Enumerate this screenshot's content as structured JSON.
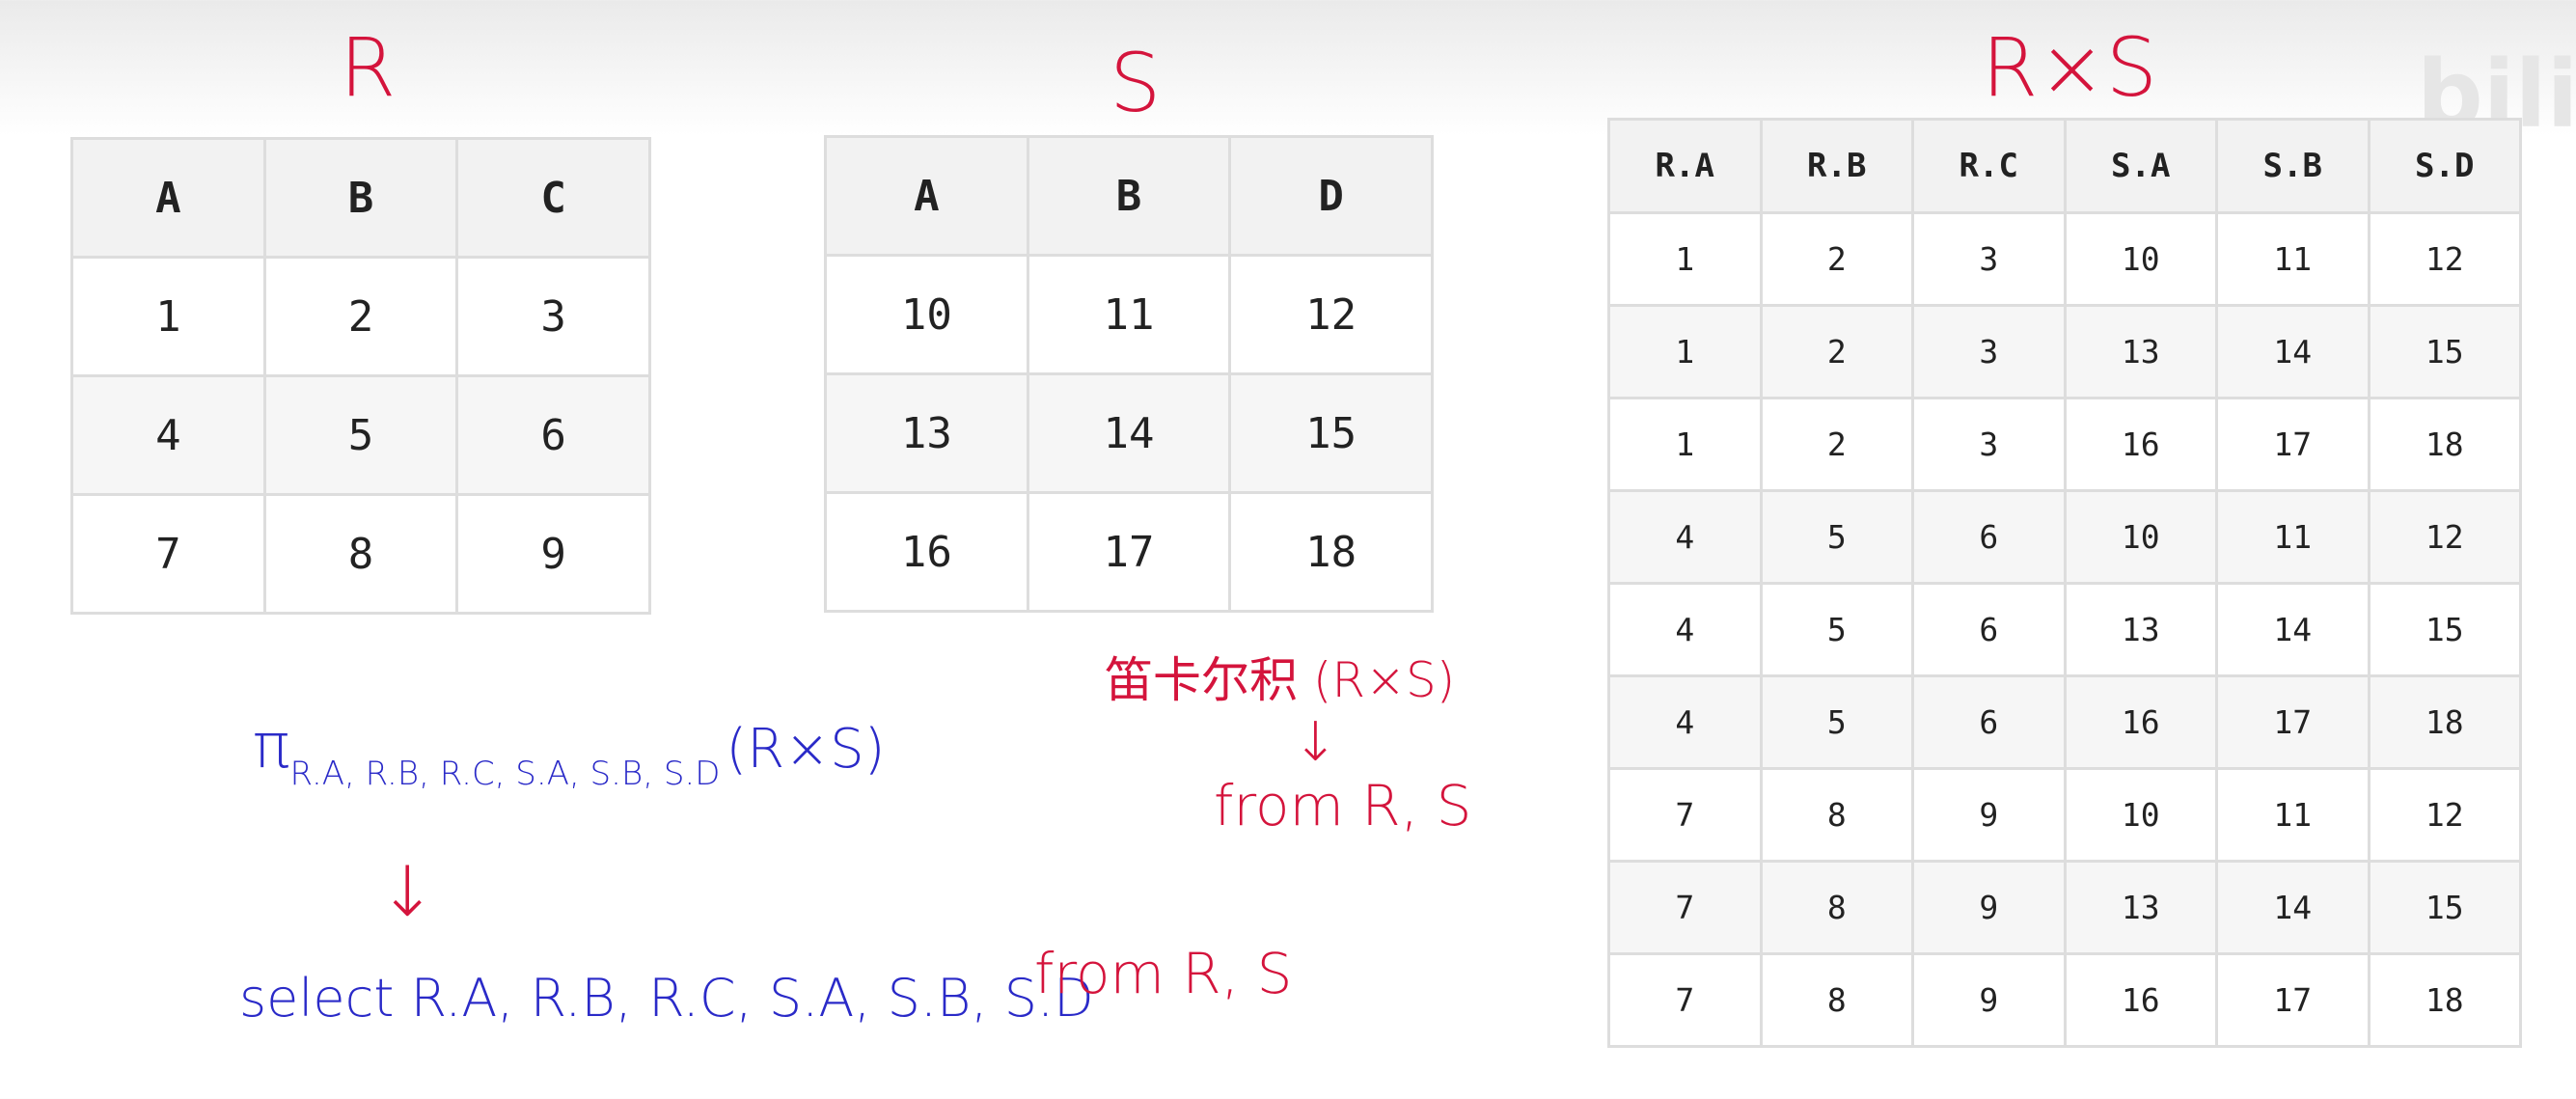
{
  "r_table": {
    "title": "R",
    "headers": [
      "A",
      "B",
      "C"
    ],
    "rows": [
      [
        "1",
        "2",
        "3"
      ],
      [
        "4",
        "5",
        "6"
      ],
      [
        "7",
        "8",
        "9"
      ]
    ]
  },
  "s_table": {
    "title": "S",
    "headers": [
      "A",
      "B",
      "D"
    ],
    "rows": [
      [
        "10",
        "11",
        "12"
      ],
      [
        "13",
        "14",
        "15"
      ],
      [
        "16",
        "17",
        "18"
      ]
    ]
  },
  "rxs_table": {
    "title": "R×S",
    "headers": [
      "R.A",
      "R.B",
      "R.C",
      "S.A",
      "S.B",
      "S.D"
    ],
    "rows": [
      [
        "1",
        "2",
        "3",
        "10",
        "11",
        "12"
      ],
      [
        "1",
        "2",
        "3",
        "13",
        "14",
        "15"
      ],
      [
        "1",
        "2",
        "3",
        "16",
        "17",
        "18"
      ],
      [
        "4",
        "5",
        "6",
        "10",
        "11",
        "12"
      ],
      [
        "4",
        "5",
        "6",
        "13",
        "14",
        "15"
      ],
      [
        "4",
        "5",
        "6",
        "16",
        "17",
        "18"
      ],
      [
        "7",
        "8",
        "9",
        "10",
        "11",
        "12"
      ],
      [
        "7",
        "8",
        "9",
        "13",
        "14",
        "15"
      ],
      [
        "7",
        "8",
        "9",
        "16",
        "17",
        "18"
      ]
    ]
  },
  "annotations": {
    "projection_symbol": "π",
    "projection_attrs": "R.A, R.B, R.C, S.A, S.B, S.D",
    "projection_arg": "(R×S)",
    "arrow": "↓",
    "select_text": "select R.A, R.B, R.C, S.A, S.B, S.D",
    "from_text": "from R, S",
    "cartesian_label": "笛卡尔积 (R×S)",
    "cartesian_from": "from R, S"
  },
  "watermark": {
    "logo": "bilib"
  }
}
